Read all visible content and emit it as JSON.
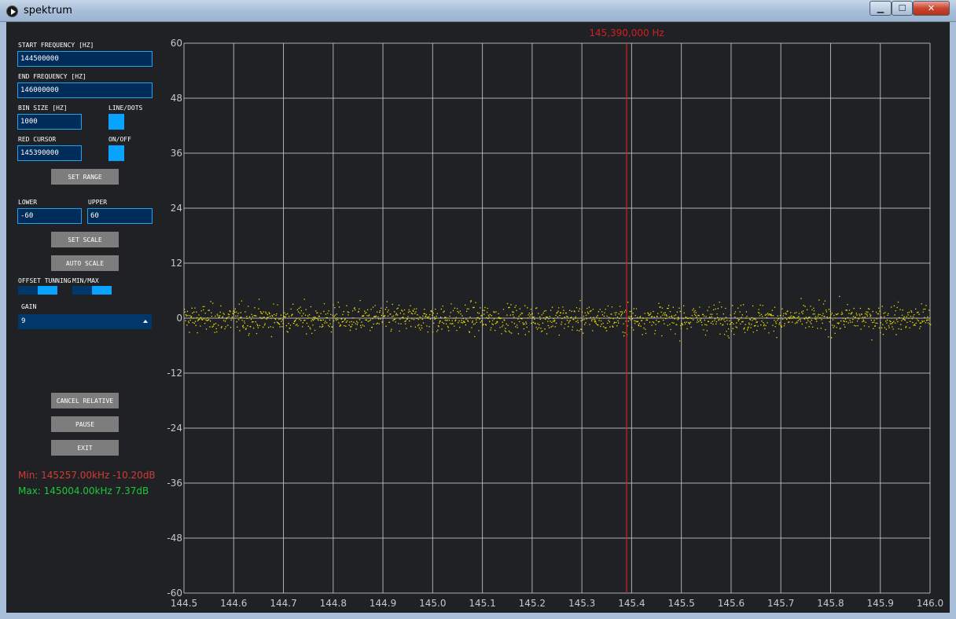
{
  "window": {
    "title": "spektrum",
    "app_icon": "play-icon",
    "buttons": {
      "minimize": "▁",
      "maximize": "☐",
      "close": "✕"
    }
  },
  "controls": {
    "start_frequency": {
      "label": "START FREQUENCY [HZ]",
      "value": "144500000"
    },
    "end_frequency": {
      "label": "END FREQUENCY [HZ]",
      "value": "146000000"
    },
    "bin_size": {
      "label": "BIN SIZE [HZ]",
      "value": "1000"
    },
    "line_dots": {
      "label": "LINE/DOTS",
      "state": true
    },
    "red_cursor": {
      "label": "RED CURSOR",
      "value": "145390000"
    },
    "on_off": {
      "label": "ON/OFF",
      "state": true
    },
    "set_range": "SET RANGE",
    "lower": {
      "label": "LOWER",
      "value": "-60"
    },
    "upper": {
      "label": "UPPER",
      "value": "60"
    },
    "set_scale": "SET SCALE",
    "auto_scale": "AUTO SCALE",
    "offset_tuning": {
      "label": "OFFSET TUNNING",
      "level": 0.5
    },
    "min_max": {
      "label": "MIN/MAX",
      "level": 0.5
    },
    "gain": {
      "label": "GAIN",
      "value": "9"
    },
    "cancel_relative": "CANCEL RELATIVE",
    "pause": "PAUSE",
    "exit": "EXIT"
  },
  "stats": {
    "min": "Min: 145257.00kHz -10.20dB",
    "max": "Max: 145004.00kHz 7.37dB",
    "min_color": "#d23c32",
    "max_color": "#1ec83c"
  },
  "chart_data": {
    "type": "scatter",
    "cursor_label": "145,390,000 Hz",
    "cursor_x": 145.39,
    "x_ticks": [
      "144.5",
      "144.6",
      "144.7",
      "144.8",
      "144.9",
      "145.0",
      "145.1",
      "145.2",
      "145.3",
      "145.4",
      "145.5",
      "145.6",
      "145.7",
      "145.8",
      "145.9",
      "146.0"
    ],
    "y_ticks": [
      "60",
      "48",
      "36",
      "24",
      "12",
      "0",
      "-12",
      "-24",
      "-36",
      "-48",
      "-60"
    ],
    "xlim": [
      144.5,
      146.0
    ],
    "ylim": [
      -60,
      60
    ],
    "grid": true,
    "series": [
      {
        "x_start": 144.5,
        "x_end": 146.0,
        "point_count": 1500,
        "noise_amplitude_db": 3.5,
        "min": -10.2,
        "max": 7.37
      }
    ],
    "colors": {
      "points": "#f0e000",
      "cursor": "#d22020",
      "grid": "#c8c8c8",
      "background": "#202124"
    }
  }
}
